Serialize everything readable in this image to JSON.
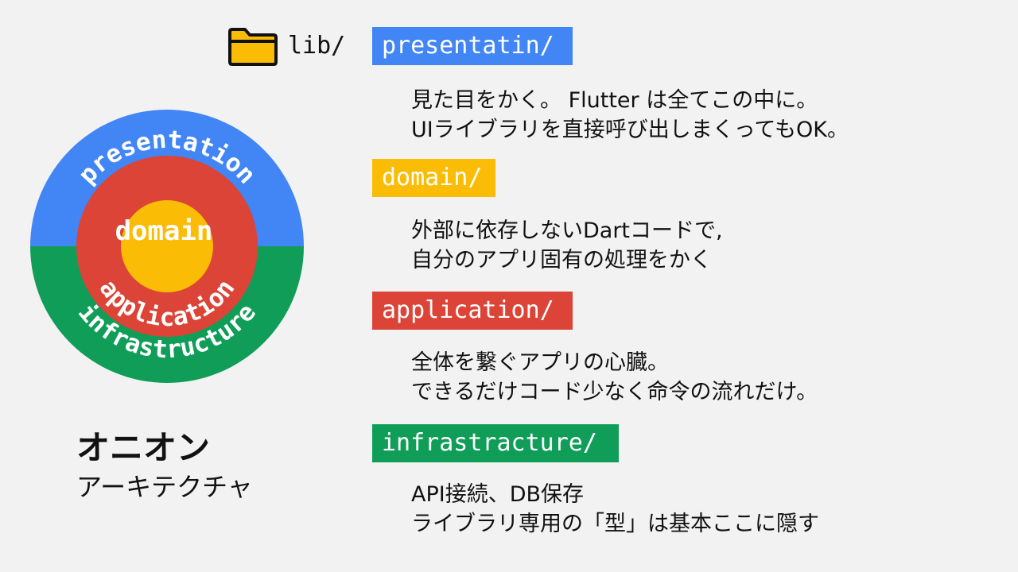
{
  "folder": {
    "icon": "folder-icon",
    "label": "lib/"
  },
  "onion": {
    "layers": {
      "outer_top": "presentation",
      "outer_bottom": "infrastructure",
      "middle": "application",
      "core": "domain"
    },
    "colors": {
      "presentation": "#4285f4",
      "infrastructure": "#0f9d58",
      "application": "#db4437",
      "domain": "#fbbc05"
    }
  },
  "title": {
    "main": "オニオン",
    "sub": "アーキテクチャ"
  },
  "sections": [
    {
      "tag": "presentatin/",
      "color": "#4285f4",
      "lines": [
        "見た目をかく。 Flutter は全てこの中に。",
        "UIライブラリを直接呼び出しまくってもOK。"
      ]
    },
    {
      "tag": "domain/",
      "color": "#fbbc05",
      "lines": [
        "外部に依存しないDartコードで,",
        "自分のアプリ固有の処理をかく"
      ]
    },
    {
      "tag": "application/",
      "color": "#db4437",
      "lines": [
        "全体を繋ぐアプリの心臓。",
        "できるだけコード少なく命令の流れだけ。"
      ]
    },
    {
      "tag": "infrastracture/",
      "color": "#0f9d58",
      "lines": [
        "API接続、DB保存",
        "ライブラリ専用の「型」は基本ここに隠す"
      ]
    }
  ]
}
